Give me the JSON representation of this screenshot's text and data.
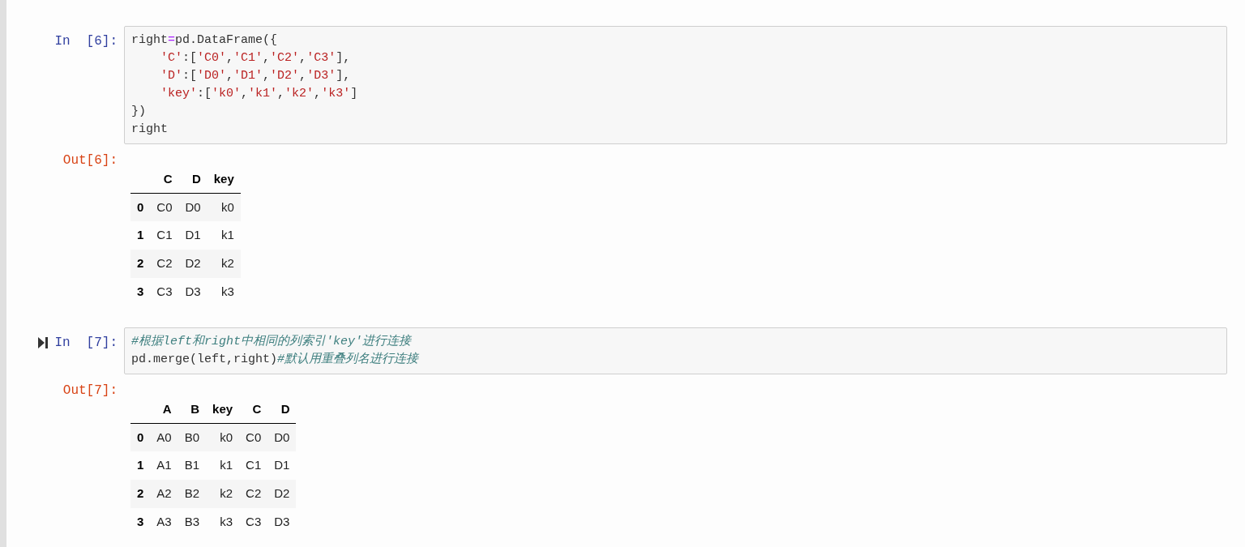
{
  "cells": [
    {
      "current": false,
      "in_label": "In",
      "in_number": "[6]:",
      "code": [
        [
          {
            "kind": "plain",
            "text": "right"
          },
          {
            "kind": "operator",
            "text": "="
          },
          {
            "kind": "plain",
            "text": "pd.DataFrame({"
          }
        ],
        [
          {
            "kind": "indent"
          },
          {
            "kind": "string",
            "text": "'C'"
          },
          {
            "kind": "plain",
            "text": ":["
          },
          {
            "kind": "string",
            "text": "'C0'"
          },
          {
            "kind": "plain",
            "text": ","
          },
          {
            "kind": "string",
            "text": "'C1'"
          },
          {
            "kind": "plain",
            "text": ","
          },
          {
            "kind": "string",
            "text": "'C2'"
          },
          {
            "kind": "plain",
            "text": ","
          },
          {
            "kind": "string",
            "text": "'C3'"
          },
          {
            "kind": "plain",
            "text": "],"
          }
        ],
        [
          {
            "kind": "indent"
          },
          {
            "kind": "string",
            "text": "'D'"
          },
          {
            "kind": "plain",
            "text": ":["
          },
          {
            "kind": "string",
            "text": "'D0'"
          },
          {
            "kind": "plain",
            "text": ","
          },
          {
            "kind": "string",
            "text": "'D1'"
          },
          {
            "kind": "plain",
            "text": ","
          },
          {
            "kind": "string",
            "text": "'D2'"
          },
          {
            "kind": "plain",
            "text": ","
          },
          {
            "kind": "string",
            "text": "'D3'"
          },
          {
            "kind": "plain",
            "text": "],"
          }
        ],
        [
          {
            "kind": "indent"
          },
          {
            "kind": "string",
            "text": "'key'"
          },
          {
            "kind": "plain",
            "text": ":["
          },
          {
            "kind": "string",
            "text": "'k0'"
          },
          {
            "kind": "plain",
            "text": ","
          },
          {
            "kind": "string",
            "text": "'k1'"
          },
          {
            "kind": "plain",
            "text": ","
          },
          {
            "kind": "string",
            "text": "'k2'"
          },
          {
            "kind": "plain",
            "text": ","
          },
          {
            "kind": "string",
            "text": "'k3'"
          },
          {
            "kind": "plain",
            "text": "]"
          }
        ],
        [
          {
            "kind": "plain",
            "text": "})"
          }
        ],
        [
          {
            "kind": "plain",
            "text": "right"
          }
        ]
      ],
      "out_label": "Out[6]:",
      "table": {
        "columns": [
          "C",
          "D",
          "key"
        ],
        "rows": [
          {
            "index": "0",
            "cells": [
              "C0",
              "D0",
              "k0"
            ]
          },
          {
            "index": "1",
            "cells": [
              "C1",
              "D1",
              "k1"
            ]
          },
          {
            "index": "2",
            "cells": [
              "C2",
              "D2",
              "k2"
            ]
          },
          {
            "index": "3",
            "cells": [
              "C3",
              "D3",
              "k3"
            ]
          }
        ]
      }
    },
    {
      "current": true,
      "in_label": "In",
      "in_number": "[7]:",
      "code": [
        [
          {
            "kind": "comment",
            "text": "#根据left和right中相同的列索引'key'进行连接"
          }
        ],
        [
          {
            "kind": "plain",
            "text": "pd.merge(left,right)"
          },
          {
            "kind": "comment",
            "text": "#默认用重叠列名进行连接"
          }
        ]
      ],
      "out_label": "Out[7]:",
      "table": {
        "columns": [
          "A",
          "B",
          "key",
          "C",
          "D"
        ],
        "rows": [
          {
            "index": "0",
            "cells": [
              "A0",
              "B0",
              "k0",
              "C0",
              "D0"
            ]
          },
          {
            "index": "1",
            "cells": [
              "A1",
              "B1",
              "k1",
              "C1",
              "D1"
            ]
          },
          {
            "index": "2",
            "cells": [
              "A2",
              "B2",
              "k2",
              "C2",
              "D2"
            ]
          },
          {
            "index": "3",
            "cells": [
              "A3",
              "B3",
              "k3",
              "C3",
              "D3"
            ]
          }
        ]
      }
    }
  ]
}
